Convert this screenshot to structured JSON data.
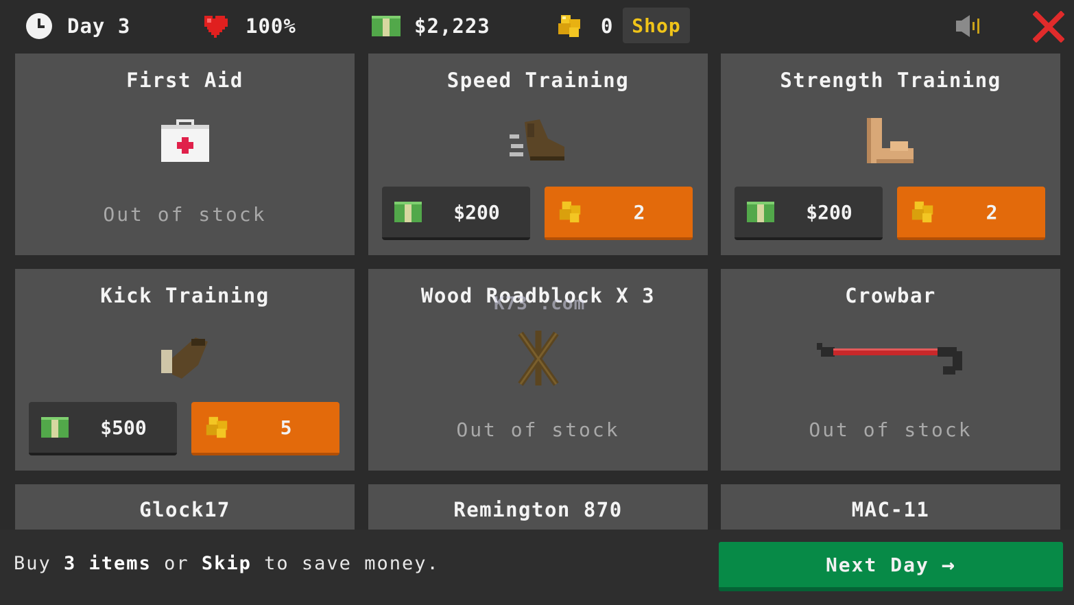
{
  "hud": {
    "day_label": "Day 3",
    "health": "100%",
    "cash": "$2,223",
    "gold": "0",
    "shop_label": "Shop"
  },
  "colors": {
    "background": "#2b2b2b",
    "card": "#505050",
    "gold_button": "#e36a0b",
    "cash_button": "#363636",
    "next_button": "#078a47",
    "shop_text": "#f0c419",
    "close_x": "#e02b2b"
  },
  "items": [
    {
      "title": "First Aid",
      "icon": "first-aid-kit-icon",
      "status": "Out of stock",
      "cash_price": "",
      "gold_price": ""
    },
    {
      "title": "Speed Training",
      "icon": "boot-icon",
      "status": "",
      "cash_price": "$200",
      "gold_price": "2"
    },
    {
      "title": "Strength Training",
      "icon": "flexed-arm-icon",
      "status": "",
      "cash_price": "$200",
      "gold_price": "2"
    },
    {
      "title": "Kick Training",
      "icon": "kick-icon",
      "status": "",
      "cash_price": "$500",
      "gold_price": "5"
    },
    {
      "title": "Wood Roadblock X 3",
      "icon": "wood-roadblock-icon",
      "status": "Out of stock",
      "cash_price": "",
      "gold_price": ""
    },
    {
      "title": "Crowbar",
      "icon": "crowbar-icon",
      "status": "Out of stock",
      "cash_price": "",
      "gold_price": ""
    },
    {
      "title": "Glock17",
      "icon": "",
      "status": "",
      "cash_price": "",
      "gold_price": ""
    },
    {
      "title": "Remington 870",
      "icon": "",
      "status": "",
      "cash_price": "",
      "gold_price": ""
    },
    {
      "title": "MAC-11",
      "icon": "",
      "status": "",
      "cash_price": "",
      "gold_price": ""
    }
  ],
  "footer": {
    "hint_parts": [
      "Buy ",
      "3 items",
      " or ",
      "Skip",
      " to save money."
    ],
    "next_label": "Next Day",
    "next_arrow": "→"
  },
  "watermark": "K73 .com"
}
